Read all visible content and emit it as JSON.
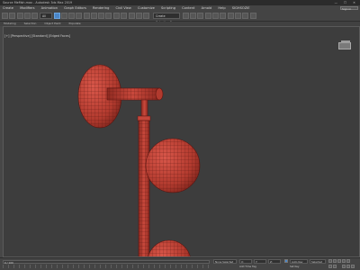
{
  "window": {
    "title": "Source MeMsh.max - Autodesk 3ds Max 2019",
    "controls": "— ☐ ✕"
  },
  "menu": {
    "items": [
      "Create",
      "Modifiers",
      "Animation",
      "Graph Editors",
      "Rendering",
      "Civil View",
      "Customize",
      "Scripting",
      "Content",
      "Arnold",
      "Help",
      "SIGHSOZIE"
    ],
    "sign_in": "Sign in"
  },
  "toolbar": {
    "filter_value": "All",
    "selection_set": "Create Selection Se"
  },
  "ribbon": {
    "tabs": [
      "Modeling",
      "Selection",
      "Object Paint",
      "Populate"
    ]
  },
  "viewport": {
    "label": "[+] [Perspective] [Standard] [Edged Faces]",
    "mesh_color": "#c0392b"
  },
  "status": {
    "frame_counter": "0 / 100",
    "none_selected": "None Selected",
    "x_label": "X:",
    "y_label": "Y:",
    "z_label": "Z:",
    "add_time_tag": "Add Time Tag",
    "auto_key": "Auto Key",
    "selected_value": "Selected",
    "set_key": "Set Key"
  }
}
